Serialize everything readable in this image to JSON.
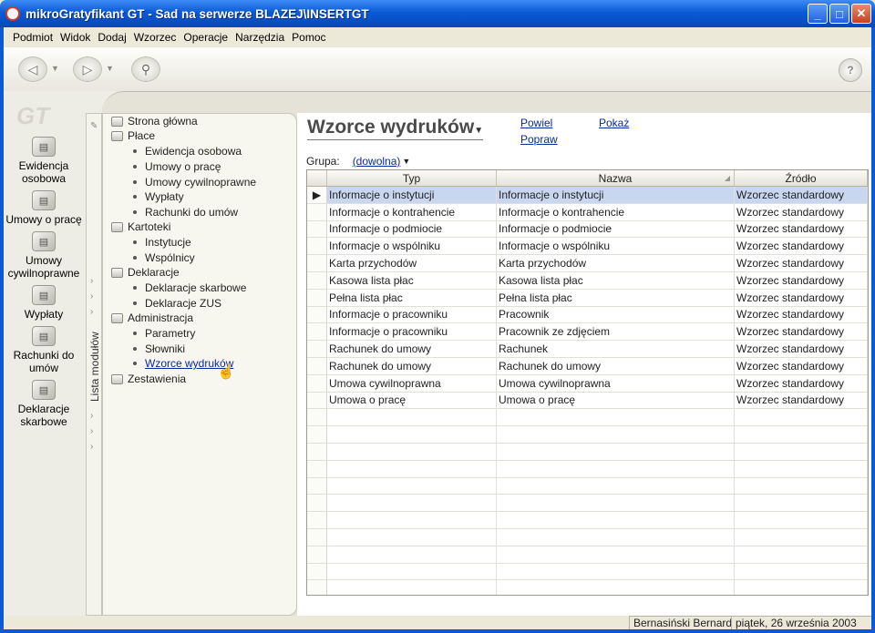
{
  "window": {
    "title": "mikroGratyfikant GT - Sad na serwerze BLAZEJ\\INSERTGT",
    "buttons": [
      "_",
      "□",
      "✕"
    ]
  },
  "menu": [
    "Podmiot",
    "Widok",
    "Dodaj",
    "Wzorzec",
    "Operacje",
    "Narzędzia",
    "Pomoc"
  ],
  "toolbar": {
    "icons": [
      "back-icon",
      "forward-icon",
      "stamp-icon",
      "help-icon"
    ]
  },
  "logo": "GT",
  "left_nav": [
    {
      "label": "Ewidencja osobowa",
      "icon": "ewidencja-icon"
    },
    {
      "label": "Umowy o pracę",
      "icon": "umowy-icon"
    },
    {
      "label": "Umowy cywilnoprawne",
      "icon": "umowy-cywilne-icon"
    },
    {
      "label": "Wypłaty",
      "icon": "wyplaty-icon"
    },
    {
      "label": "Rachunki do umów",
      "icon": "rachunki-icon"
    },
    {
      "label": "Deklaracje skarbowe",
      "icon": "deklaracje-icon"
    }
  ],
  "module_strip_label": "Lista modułów",
  "tree": {
    "home": "Strona główna",
    "groups": [
      {
        "label": "Płace",
        "items": [
          "Ewidencja osobowa",
          "Umowy o pracę",
          "Umowy cywilnoprawne",
          "Wypłaty",
          "Rachunki do umów"
        ]
      },
      {
        "label": "Kartoteki",
        "items": [
          "Instytucje",
          "Wspólnicy"
        ]
      },
      {
        "label": "Deklaracje",
        "items": [
          "Deklaracje skarbowe",
          "Deklaracje ZUS"
        ]
      },
      {
        "label": "Administracja",
        "items": [
          "Parametry",
          "Słowniki",
          "Wzorce wydruków"
        ]
      },
      {
        "label": "Zestawienia",
        "items": []
      }
    ],
    "active": "Wzorce wydruków"
  },
  "content": {
    "title": "Wzorce wydruków",
    "actions": {
      "powiel": "Powiel",
      "popraw": "Popraw",
      "pokaz": "Pokaż"
    },
    "group_label": "Grupa:",
    "group_value": "(dowolna)"
  },
  "grid": {
    "columns": [
      "Typ",
      "Nazwa",
      "Źródło"
    ],
    "rows": [
      [
        "Informacje o instytucji",
        "Informacje o instytucji",
        "Wzorzec standardowy"
      ],
      [
        "Informacje o kontrahencie",
        "Informacje o kontrahencie",
        "Wzorzec standardowy"
      ],
      [
        "Informacje o podmiocie",
        "Informacje o podmiocie",
        "Wzorzec standardowy"
      ],
      [
        "Informacje o wspólniku",
        "Informacje o wspólniku",
        "Wzorzec standardowy"
      ],
      [
        "Karta przychodów",
        "Karta przychodów",
        "Wzorzec standardowy"
      ],
      [
        "Kasowa lista płac",
        "Kasowa lista płac",
        "Wzorzec standardowy"
      ],
      [
        "Pełna lista płac",
        "Pełna lista płac",
        "Wzorzec standardowy"
      ],
      [
        "Informacje o pracowniku",
        "Pracownik",
        "Wzorzec standardowy"
      ],
      [
        "Informacje o pracowniku",
        "Pracownik ze zdjęciem",
        "Wzorzec standardowy"
      ],
      [
        "Rachunek do umowy",
        "Rachunek",
        "Wzorzec standardowy"
      ],
      [
        "Rachunek do umowy",
        "Rachunek do umowy",
        "Wzorzec standardowy"
      ],
      [
        "Umowa cywilnoprawna",
        "Umowa cywilnoprawna",
        "Wzorzec standardowy"
      ],
      [
        "Umowa o pracę",
        "Umowa o pracę",
        "Wzorzec standardowy"
      ]
    ],
    "selected_row": 0,
    "empty_rows": 11
  },
  "status": {
    "user": "Bernasiński Bernard",
    "date": "piątek, 26 września 2003"
  }
}
